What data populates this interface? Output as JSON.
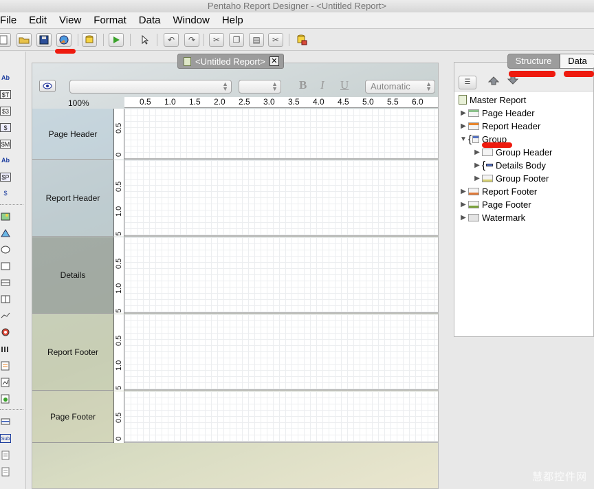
{
  "window": {
    "title": "Pentaho Report Designer - <Untitled Report>"
  },
  "menu": [
    "File",
    "Edit",
    "View",
    "Format",
    "Data",
    "Window",
    "Help"
  ],
  "toolbar": {
    "buttons": [
      "new-file-icon",
      "open-folder-icon",
      "save-disk-icon",
      "publish-globe-icon",
      "datasource-cylinder-icon",
      "run-play-icon",
      "select-pointer-icon",
      "undo-icon",
      "redo-icon",
      "cut-icon",
      "copy-icon",
      "paste-icon",
      "delete-scissors-icon",
      "add-datasource-icon"
    ]
  },
  "palette": {
    "items": [
      "Ab",
      "$T",
      "$3",
      "$",
      "$M",
      "Ab",
      "$P",
      "$",
      "image",
      "chart",
      "ellipse",
      "rectangle",
      "horizontal-line",
      "vertical-line",
      "survey-scale",
      "banded",
      "band",
      "sub-report",
      "table",
      "resource"
    ]
  },
  "editor": {
    "tab_title": "<Untitled Report>",
    "font_combo": "",
    "size_combo": "",
    "color_combo": "Automatic",
    "style_buttons": {
      "bold": "B",
      "italic": "I",
      "underline": "U"
    },
    "zoom": "100%",
    "ruler_labels": [
      "0.5",
      "1.0",
      "1.5",
      "2.0",
      "2.5",
      "3.0",
      "3.5",
      "4.0",
      "4.5",
      "5.0",
      "5.5",
      "6.0"
    ],
    "bands": [
      {
        "label": "Page Header",
        "ruler": [
          "0",
          "0.5"
        ]
      },
      {
        "label": "Report Header",
        "ruler": [
          "0.5",
          "1.0",
          "5"
        ]
      },
      {
        "label": "Details",
        "ruler": [
          "0.5",
          "1.0",
          "5"
        ]
      },
      {
        "label": "Report Footer",
        "ruler": [
          "0.5",
          "1.0",
          "5"
        ]
      },
      {
        "label": "Page Footer",
        "ruler": [
          "0",
          "0.5"
        ]
      }
    ]
  },
  "structure_panel": {
    "tabs": [
      "Structure",
      "Data"
    ],
    "active_tab": "Structure",
    "tree": [
      {
        "label": "Master Report",
        "level": 0,
        "arrow": ""
      },
      {
        "label": "Page Header",
        "level": 1,
        "arrow": "▶"
      },
      {
        "label": "Report Header",
        "level": 1,
        "arrow": "▶"
      },
      {
        "label": "Group",
        "level": 1,
        "arrow": "▼"
      },
      {
        "label": "Group Header",
        "level": 2,
        "arrow": "▶"
      },
      {
        "label": "Details Body",
        "level": 2,
        "arrow": "▶"
      },
      {
        "label": "Group Footer",
        "level": 2,
        "arrow": "▶"
      },
      {
        "label": "Report Footer",
        "level": 1,
        "arrow": "▶"
      },
      {
        "label": "Page Footer",
        "level": 1,
        "arrow": "▶"
      },
      {
        "label": "Watermark",
        "level": 1,
        "arrow": "▶"
      }
    ]
  },
  "watermark": "慧都控件网",
  "colors": {
    "annotation_red": "#ee1a0e",
    "tab_active": "#9c9c9c"
  }
}
